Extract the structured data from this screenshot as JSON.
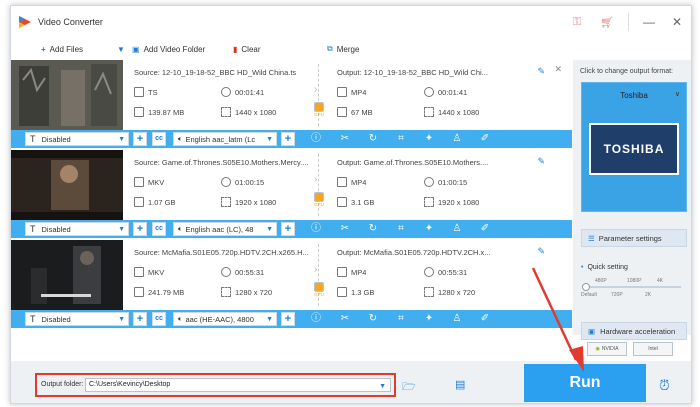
{
  "app": {
    "title": "Video Converter"
  },
  "toolbar": {
    "add_files": "Add Files",
    "add_video_folder": "Add Video Folder",
    "clear": "Clear",
    "merge": "Merge"
  },
  "files": [
    {
      "source": "Source: 12-10_19-18-52_BBC HD_Wild China.ts",
      "src_format": "TS",
      "src_duration": "00:01:41",
      "src_size": "139.87 MB",
      "src_res": "1440 x 1080",
      "output": "Output: 12-10_19-18-52_BBC HD_Wild Chi...",
      "out_format": "MP4",
      "out_duration": "00:01:41",
      "out_size": "67 MB",
      "out_res": "1440 x 1080",
      "subtitle": "Disabled",
      "audio": "English aac_latm (Lc"
    },
    {
      "source": "Source: Game.of.Thrones.S05E10.Mothers.Mercy....",
      "src_format": "MKV",
      "src_duration": "01:00:15",
      "src_size": "1.07 GB",
      "src_res": "1920 x 1080",
      "output": "Output: Game.of.Thrones.S05E10.Mothers....",
      "out_format": "MP4",
      "out_duration": "01:00:15",
      "out_size": "3.1 GB",
      "out_res": "1920 x 1080",
      "subtitle": "Disabled",
      "audio": "English aac (LC), 48"
    },
    {
      "source": "Source: McMafia.S01E05.720p.HDTV.2CH.x265.H...",
      "src_format": "MKV",
      "src_duration": "00:55:31",
      "src_size": "241.79 MB",
      "src_res": "1280 x 720",
      "output": "Output: McMafia.S01E05.720p.HDTV.2CH.x...",
      "out_format": "MP4",
      "out_duration": "00:55:31",
      "out_size": "1.3 GB",
      "out_res": "1280 x 720",
      "subtitle": "Disabled",
      "audio": "aac (HE-AAC), 4800"
    }
  ],
  "gpu_label": "GPU",
  "right_panel": {
    "title": "Click to change output format:",
    "profile_name": "Toshiba",
    "profile_logo": "TOSHIBA",
    "parameter_settings": "Parameter settings",
    "quick_setting": "Quick setting",
    "ticks_top": [
      "480P",
      "1080P",
      "4K"
    ],
    "ticks_bottom": [
      "Default",
      "720P",
      "2K"
    ],
    "hw_accel": "Hardware acceleration",
    "chip_nvidia": "NVIDIA",
    "chip_intel": "Intel"
  },
  "bottom": {
    "output_folder_label": "Output folder:",
    "output_folder_value": "C:\\Users\\Kevincy\\Desktop",
    "run_label": "Run"
  },
  "colors": {
    "accent": "#41aef0",
    "run": "#2ba0f0",
    "highlight": "#e23a2f"
  }
}
